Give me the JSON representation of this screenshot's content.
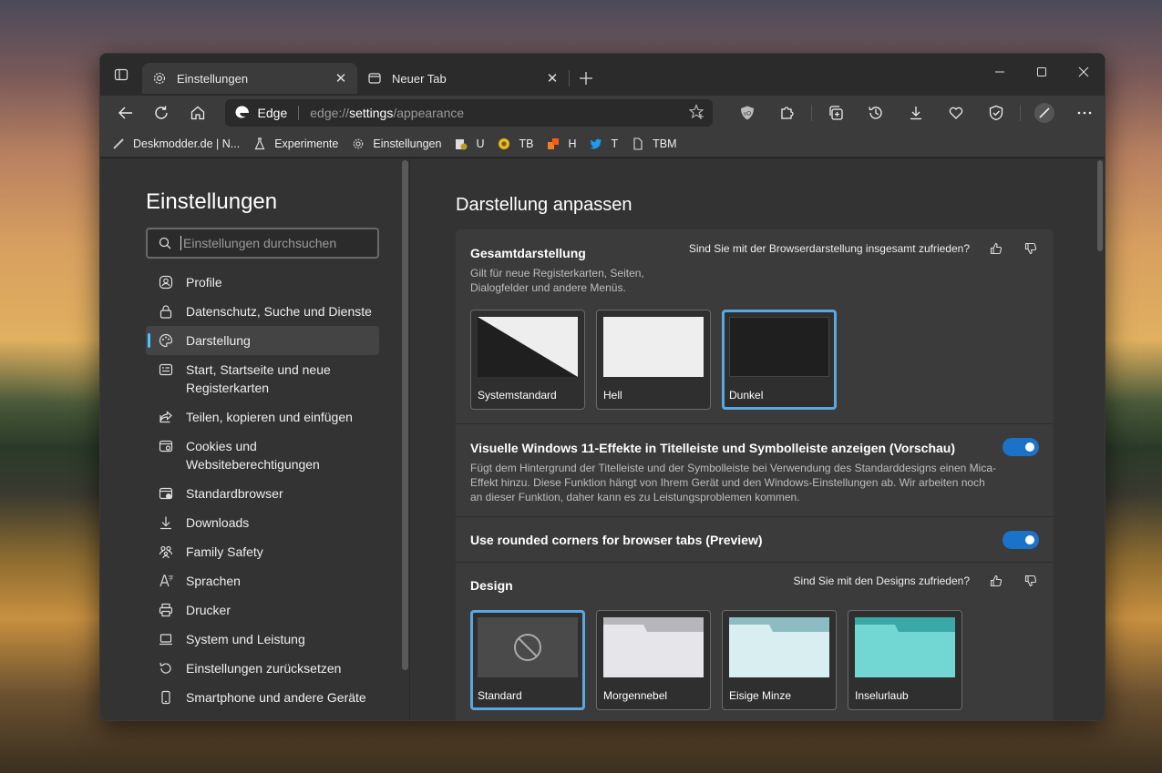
{
  "window": {
    "tabs": [
      {
        "title": "Einstellungen",
        "icon": "gear-icon"
      },
      {
        "title": "Neuer Tab",
        "icon": "new-tab-icon"
      }
    ]
  },
  "toolbar": {
    "address_brand": "Edge",
    "url_scheme": "edge://",
    "url_host": "settings",
    "url_path": "/appearance"
  },
  "favorites": [
    {
      "label": "Deskmodder.de | N...",
      "icon": "deskmodder-icon"
    },
    {
      "label": "Experimente",
      "icon": "flask-icon"
    },
    {
      "label": "Einstellungen",
      "icon": "gear-icon"
    },
    {
      "label": "U",
      "icon": "u-icon"
    },
    {
      "label": "TB",
      "icon": "tb-icon"
    },
    {
      "label": "H",
      "icon": "h-icon"
    },
    {
      "label": "T",
      "icon": "twitter-icon"
    },
    {
      "label": "TBM",
      "icon": "page-icon"
    }
  ],
  "sidebar": {
    "title": "Einstellungen",
    "search_placeholder": "Einstellungen durchsuchen",
    "items": [
      {
        "label": "Profile",
        "icon": "profile-icon"
      },
      {
        "label": "Datenschutz, Suche und Dienste",
        "icon": "lock-icon"
      },
      {
        "label": "Darstellung",
        "icon": "palette-icon",
        "active": true
      },
      {
        "label": "Start, Startseite und neue Registerkarten",
        "icon": "start-icon"
      },
      {
        "label": "Teilen, kopieren und einfügen",
        "icon": "share-icon"
      },
      {
        "label": "Cookies und Websiteberechtigungen",
        "icon": "cookie-icon"
      },
      {
        "label": "Standardbrowser",
        "icon": "browser-icon"
      },
      {
        "label": "Downloads",
        "icon": "download-icon"
      },
      {
        "label": "Family Safety",
        "icon": "family-icon"
      },
      {
        "label": "Sprachen",
        "icon": "language-icon"
      },
      {
        "label": "Drucker",
        "icon": "printer-icon"
      },
      {
        "label": "System und Leistung",
        "icon": "laptop-icon"
      },
      {
        "label": "Einstellungen zurücksetzen",
        "icon": "reset-icon"
      },
      {
        "label": "Smartphone und andere Geräte",
        "icon": "phone-icon"
      }
    ]
  },
  "main": {
    "title": "Darstellung anpassen",
    "overall": {
      "title": "Gesamtdarstellung",
      "desc_line1": "Gilt für neue Registerkarten, Seiten,",
      "desc_line2": "Dialogfelder und andere Menüs.",
      "feedback": "Sind Sie mit der Browserdarstellung insgesamt zufrieden?",
      "themes": [
        {
          "label": "Systemstandard",
          "selected": false
        },
        {
          "label": "Hell",
          "selected": false
        },
        {
          "label": "Dunkel",
          "selected": true
        }
      ]
    },
    "mica": {
      "title": "Visuelle Windows 11-Effekte in Titelleiste und Symbolleiste anzeigen (Vorschau)",
      "desc_line1": "Fügt dem Hintergrund der Titelleiste und der Symbolleiste bei Verwendung des Standarddesigns einen Mica-",
      "desc_line2": "Effekt hinzu. Diese Funktion hängt von Ihrem Gerät und den Windows-Einstellungen ab. Wir arbeiten noch",
      "desc_line3": "an dieser Funktion, daher kann es zu Leistungsproblemen kommen.",
      "enabled": true
    },
    "rounded": {
      "title": "Use rounded corners for browser tabs (Preview)",
      "enabled": true
    },
    "design": {
      "title": "Design",
      "feedback": "Sind Sie mit den Designs zufrieden?",
      "themes": [
        {
          "label": "Standard",
          "selected": true,
          "color": "#4a4a4a"
        },
        {
          "label": "Morgennebel",
          "selected": false,
          "color": "#dcdce0"
        },
        {
          "label": "Eisige Minze",
          "selected": false,
          "color": "#cfe6ea"
        },
        {
          "label": "Inselurlaub",
          "selected": false,
          "color": "#6fd3d0"
        }
      ]
    }
  }
}
